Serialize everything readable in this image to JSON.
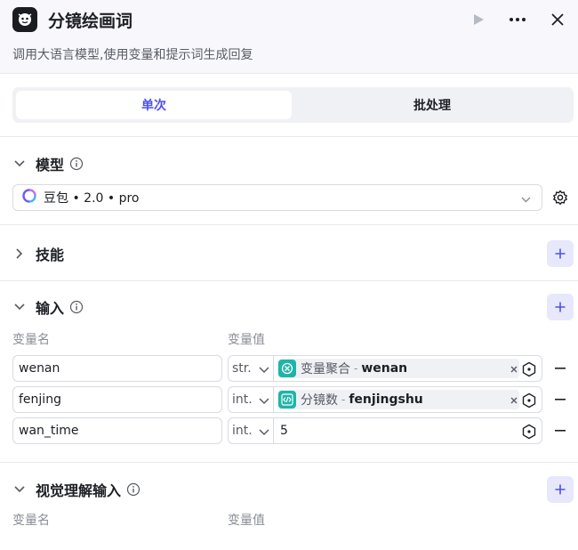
{
  "header": {
    "title": "分镜绘画词",
    "subtitle": "调用大语言模型,使用变量和提示词生成回复"
  },
  "tabs": [
    {
      "label": "单次",
      "active": true
    },
    {
      "label": "批处理",
      "active": false
    }
  ],
  "model_section": {
    "title": "模型",
    "selected_model": "豆包 • 2.0 • pro"
  },
  "skills_section": {
    "title": "技能"
  },
  "input_section": {
    "title": "输入",
    "col_name": "变量名",
    "col_value": "变量值",
    "rows": [
      {
        "name": "wenan",
        "type": "str.",
        "value_kind": "ref",
        "icon": "aggregate-icon",
        "node": "变量聚合",
        "variable": "wenan"
      },
      {
        "name": "fenjing",
        "type": "int.",
        "value_kind": "ref",
        "icon": "code-icon",
        "node": "分镜数",
        "variable": "fenjingshu"
      },
      {
        "name": "wan_time",
        "type": "int.",
        "value_kind": "literal",
        "value": "5"
      }
    ]
  },
  "vision_section": {
    "title": "视觉理解输入",
    "col_name": "变量名",
    "col_value": "变量值"
  },
  "colors": {
    "accent": "#4d53e8",
    "chip_icon": "#1fb4a8",
    "add_button_bg": "#e7e8fb"
  }
}
